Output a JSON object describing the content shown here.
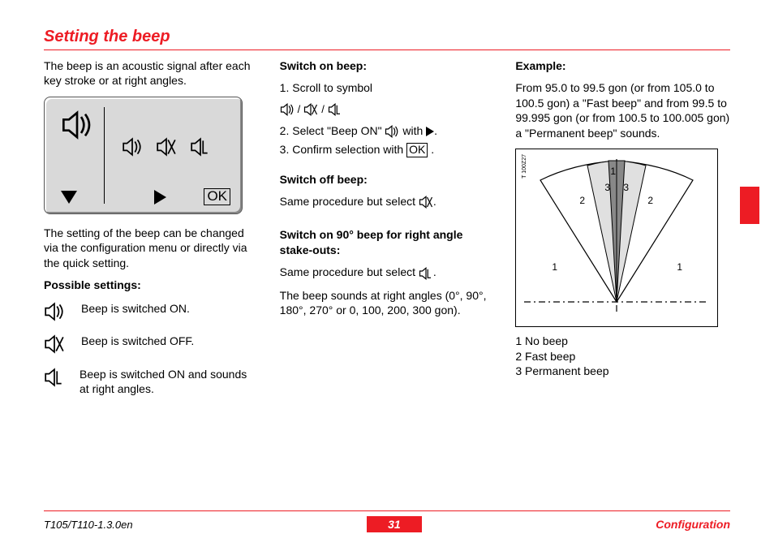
{
  "header": {
    "title": "Setting the beep"
  },
  "col1": {
    "intro": "The beep is an acoustic signal after each key stroke or at right angles.",
    "after_screen": "The setting of the beep can be changed via the configuration menu or directly via the quick setting.",
    "possible_settings_label": "Possible settings:",
    "settings": [
      {
        "text": "Beep is switched ON."
      },
      {
        "text": "Beep is switched OFF."
      },
      {
        "text": "Beep is switched ON and sounds at right angles."
      }
    ],
    "ok_label": "OK"
  },
  "col2": {
    "switch_on_label": "Switch on beep:",
    "step1": "1. Scroll to symbol",
    "step2_a": "2. Select \"Beep ON\" ",
    "step2_b": " with ",
    "step2_c": ".",
    "step3_a": "3. Confirm selection with ",
    "step3_b": ".",
    "switch_off_label": "Switch off beep:",
    "switch_off_text_a": "Same procedure but select ",
    "switch_off_text_b": ".",
    "right_angle_label": "Switch on 90° beep for right angle stake-outs:",
    "right_angle_text_a": "Same procedure but select ",
    "right_angle_text_b": ".",
    "right_angle_extra": "The beep sounds at right angles (0°, 90°, 180°, 270° or 0, 100, 200, 300 gon).",
    "slash": "/",
    "ok_label": "OK"
  },
  "col3": {
    "example_label": "Example:",
    "example_text": "From 95.0 to 99.5 gon (or from 105.0 to 100.5 gon) a \"Fast beep\" and from 99.5 to 99.995 gon (or from 100.5 to 100.005 gon) a \"Permanent beep\" sounds.",
    "diagram_code": "T 100Z27",
    "legend": {
      "l1": "1  No beep",
      "l2": "2  Fast beep",
      "l3": "3  Permanent beep"
    },
    "nums": {
      "n1": "1",
      "n2": "2",
      "n3": "3"
    }
  },
  "footer": {
    "doc": "T105/T110-1.3.0en",
    "page": "31",
    "section": "Configuration"
  }
}
